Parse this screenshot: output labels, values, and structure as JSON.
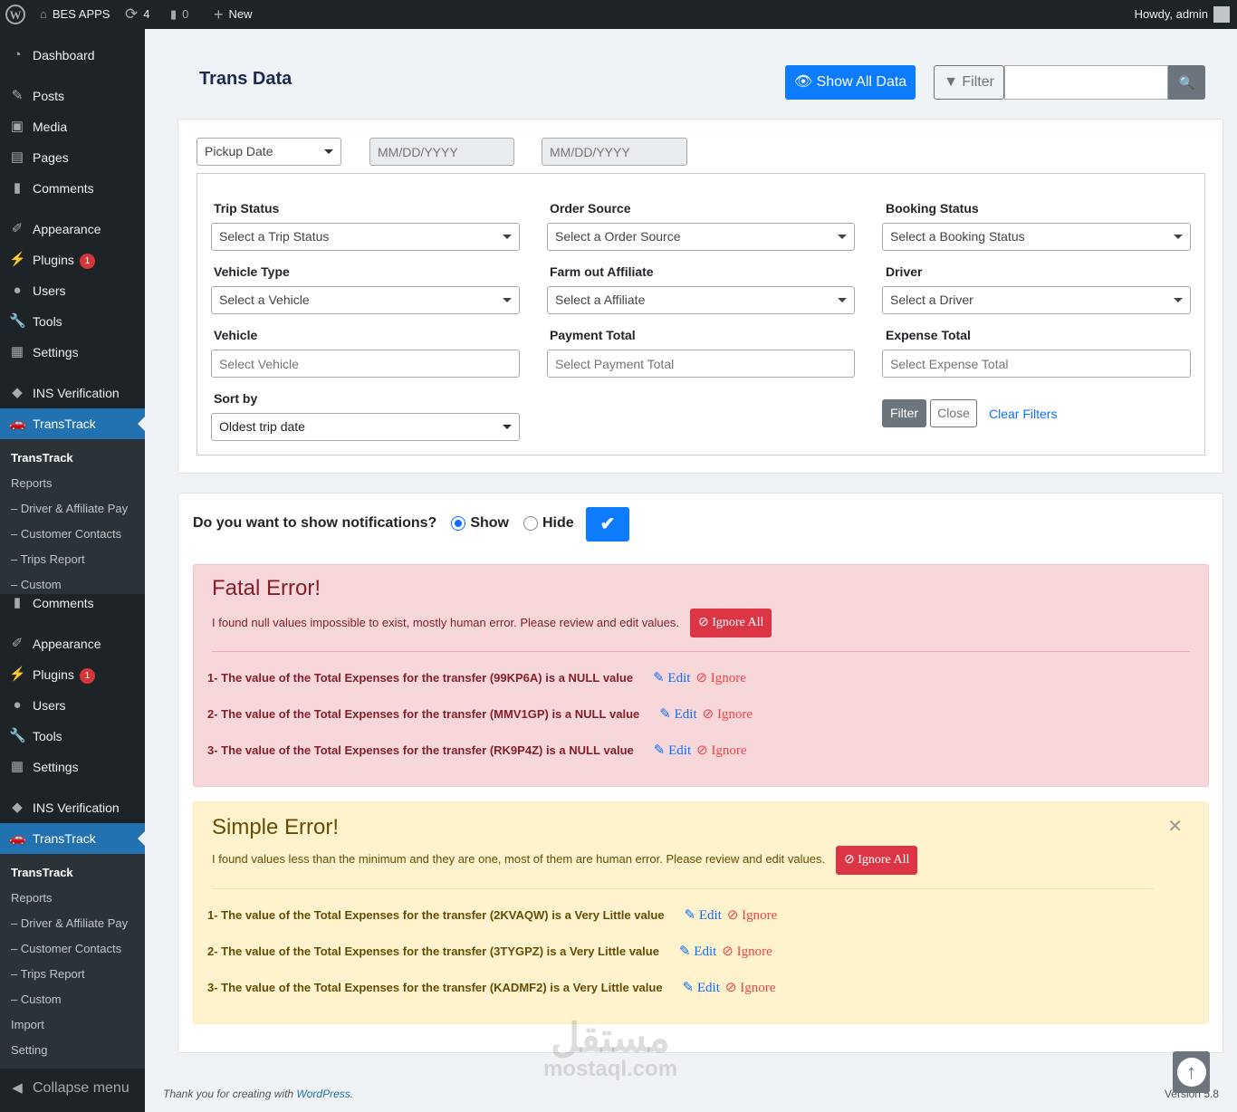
{
  "adminbar": {
    "site": "BES APPS",
    "updates": "4",
    "comments": "0",
    "new": "New",
    "howdy": "Howdy, admin"
  },
  "sidebar": {
    "items": [
      {
        "label": "Dashboard",
        "icon": "dashboard-icon"
      },
      {
        "label": "Posts",
        "icon": "pin-icon"
      },
      {
        "label": "Media",
        "icon": "media-icon"
      },
      {
        "label": "Pages",
        "icon": "pages-icon"
      },
      {
        "label": "Comments",
        "icon": "comment-icon"
      },
      {
        "label": "Appearance",
        "icon": "brush-icon"
      },
      {
        "label": "Plugins",
        "icon": "plugin-icon",
        "badge": "1"
      },
      {
        "label": "Users",
        "icon": "user-icon"
      },
      {
        "label": "Tools",
        "icon": "wrench-icon"
      },
      {
        "label": "Settings",
        "icon": "settings-icon"
      },
      {
        "label": "INS Verification",
        "icon": "tag-icon"
      },
      {
        "label": "TransTrack",
        "icon": "car-icon",
        "active": true
      },
      {
        "label": "Comments",
        "icon": "comment-icon"
      },
      {
        "label": "Appearance",
        "icon": "brush-icon"
      },
      {
        "label": "Plugins",
        "icon": "plugin-icon",
        "badge": "1"
      },
      {
        "label": "Users",
        "icon": "user-icon"
      },
      {
        "label": "Tools",
        "icon": "wrench-icon"
      },
      {
        "label": "Settings",
        "icon": "settings-icon"
      },
      {
        "label": "INS Verification",
        "icon": "tag-icon"
      },
      {
        "label": "TransTrack",
        "icon": "car-icon",
        "active": true
      }
    ],
    "submenu1": [
      "TransTrack",
      "Reports",
      "– Driver & Affiliate Pay",
      "– Customer Contacts",
      "– Trips Report",
      "– Custom"
    ],
    "submenu2": [
      "TransTrack",
      "Reports",
      "– Driver & Affiliate Pay",
      "– Customer Contacts",
      "– Trips Report",
      "– Custom",
      "Import",
      "Setting"
    ],
    "collapse": "Collapse menu"
  },
  "header": {
    "title": "Trans Data",
    "show_all": "Show All Data",
    "filter": "Filter",
    "search_value": ""
  },
  "filters": {
    "date_type": "Pickup Date",
    "date_from_placeholder": "MM/DD/YYYY",
    "date_to_placeholder": "MM/DD/YYYY",
    "trip_status": {
      "label": "Trip Status",
      "value": "Select a Trip Status"
    },
    "order_source": {
      "label": "Order Source",
      "value": "Select a Order Source"
    },
    "booking_status": {
      "label": "Booking Status",
      "value": "Select a Booking Status"
    },
    "vehicle_type": {
      "label": "Vehicle Type",
      "value": "Select a Vehicle"
    },
    "farm_out": {
      "label": "Farm out Affiliate",
      "value": "Select a Affiliate"
    },
    "driver": {
      "label": "Driver",
      "value": "Select a Driver"
    },
    "vehicle": {
      "label": "Vehicle",
      "placeholder": "Select Vehicle"
    },
    "payment_total": {
      "label": "Payment Total",
      "placeholder": "Select Payment Total"
    },
    "expense_total": {
      "label": "Expense Total",
      "placeholder": "Select Expense Total"
    },
    "sort_by": {
      "label": "Sort by",
      "value": "Oldest trip date"
    },
    "filter_btn": "Filter",
    "close_btn": "Close",
    "clear": "Clear Filters"
  },
  "notifications": {
    "question": "Do you want to show notifications?",
    "show": "Show",
    "hide": "Hide",
    "selected": "Show"
  },
  "fatal": {
    "title": "Fatal Error!",
    "desc": "I found null values impossible to exist, mostly human error. Please review and edit values.",
    "ignore_all": "Ignore All",
    "rows": [
      {
        "n": "1- ",
        "pre": "The value of the Total Expenses for the transfer (99KP6A) is a ",
        "b": "NULL",
        "post": " value"
      },
      {
        "n": "2- ",
        "pre": "The value of the Total Expenses for the transfer (MMV1GP) is a ",
        "b": "NULL",
        "post": " value"
      },
      {
        "n": "3- ",
        "pre": "The value of the Total Expenses for the transfer (RK9P4Z) is a ",
        "b": "NULL",
        "post": " value"
      }
    ]
  },
  "simple": {
    "title": "Simple Error!",
    "desc": "I found values less than the minimum and they are one, most of them are human error. Please review and edit values.",
    "ignore_all": "Ignore All",
    "rows": [
      {
        "n": "1- ",
        "pre": "The value of the Total Expenses for the transfer (2KVAQW) is a ",
        "b": "Very Little",
        "post": " value"
      },
      {
        "n": "2- ",
        "pre": "The value of the Total Expenses for the transfer (3TYGPZ) is a ",
        "b": "Very Little",
        "post": " value"
      },
      {
        "n": "3- ",
        "pre": "The value of the Total Expenses for the transfer (KADMF2) is a ",
        "b": "Very Little",
        "post": " value"
      }
    ]
  },
  "actions": {
    "edit": "Edit",
    "ignore": "Ignore"
  },
  "footer": {
    "thanks": "Thank you for creating with ",
    "wp": "WordPress",
    "dot": ".",
    "version": "Version 5.8"
  },
  "watermark": {
    "arabic": "مستقل",
    "latin": "mostaql.com"
  }
}
